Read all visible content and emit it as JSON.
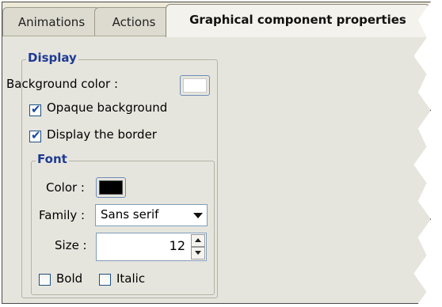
{
  "tabs": [
    {
      "label": "Animations",
      "active": false
    },
    {
      "label": "Actions",
      "active": false
    },
    {
      "label": "Graphical component properties",
      "active": true
    }
  ],
  "display": {
    "legend": "Display",
    "background_color_label": "Background color :",
    "background_color": "#ffffff",
    "opaque_background": {
      "label": "Opaque background",
      "checked": true
    },
    "display_border": {
      "label": "Display the border",
      "checked": true
    }
  },
  "font": {
    "legend": "Font",
    "color_label": "Color :",
    "color": "#000000",
    "family_label": "Family :",
    "family_value": "Sans serif",
    "size_label": "Size :",
    "size_value": "12",
    "bold": {
      "label": "Bold",
      "checked": false
    },
    "italic": {
      "label": "Italic",
      "checked": false
    }
  },
  "icons": {
    "checkbox_checked": "check-icon",
    "dropdown": "chevron-down-icon",
    "spinner_up": "arrow-up-icon",
    "spinner_down": "arrow-down-icon"
  },
  "colors": {
    "legend_text": "#1f3a93",
    "panel_bg": "#e6e5dd",
    "checkbox_border": "#1c5180"
  }
}
